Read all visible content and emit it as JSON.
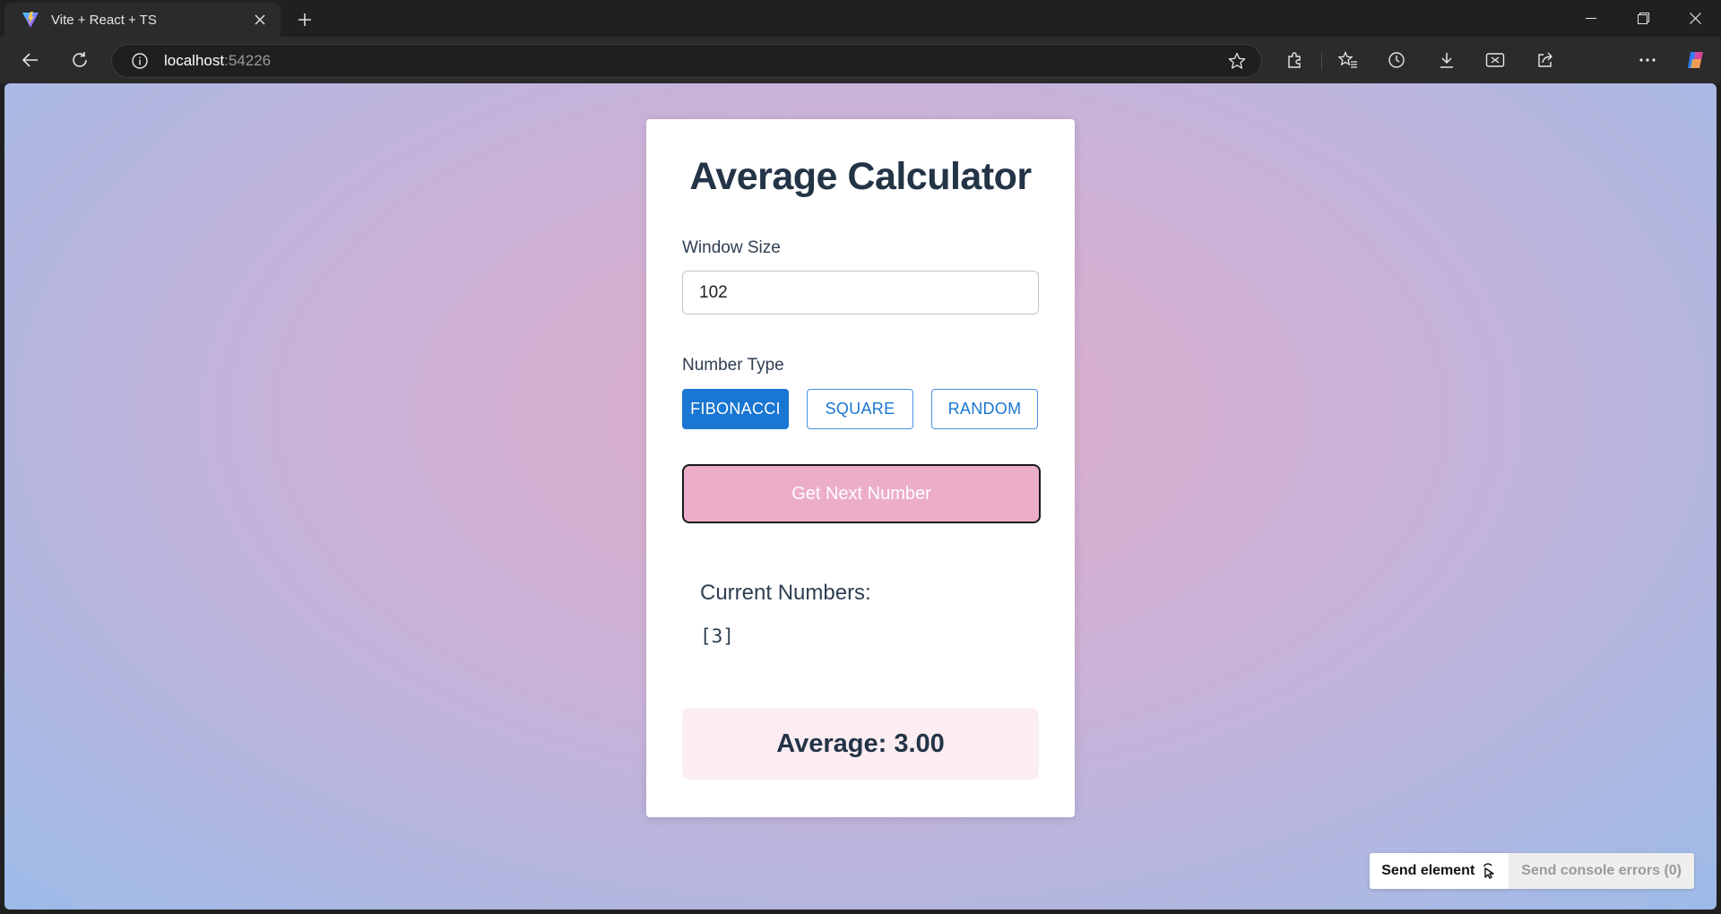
{
  "browser": {
    "tab_title": "Vite + React + TS",
    "url_host": "localhost",
    "url_port": ":54226"
  },
  "app": {
    "title": "Average Calculator",
    "window_size_label": "Window Size",
    "window_size_value": "102",
    "number_type_label": "Number Type",
    "number_types": [
      "FIBONACCI",
      "SQUARE",
      "RANDOM"
    ],
    "selected_type": "FIBONACCI",
    "next_button_label": "Get Next Number",
    "current_numbers_label": "Current Numbers:",
    "current_numbers_value": "[3]",
    "average_text": "Average: 3.00"
  },
  "overlay": {
    "send_element_label": "Send element",
    "send_console_label": "Send console errors (0)"
  },
  "colors": {
    "primary": "#1976d2",
    "next_button_bg": "#ecadc8",
    "average_bg": "#fbedf2",
    "title_text": "#243447"
  }
}
